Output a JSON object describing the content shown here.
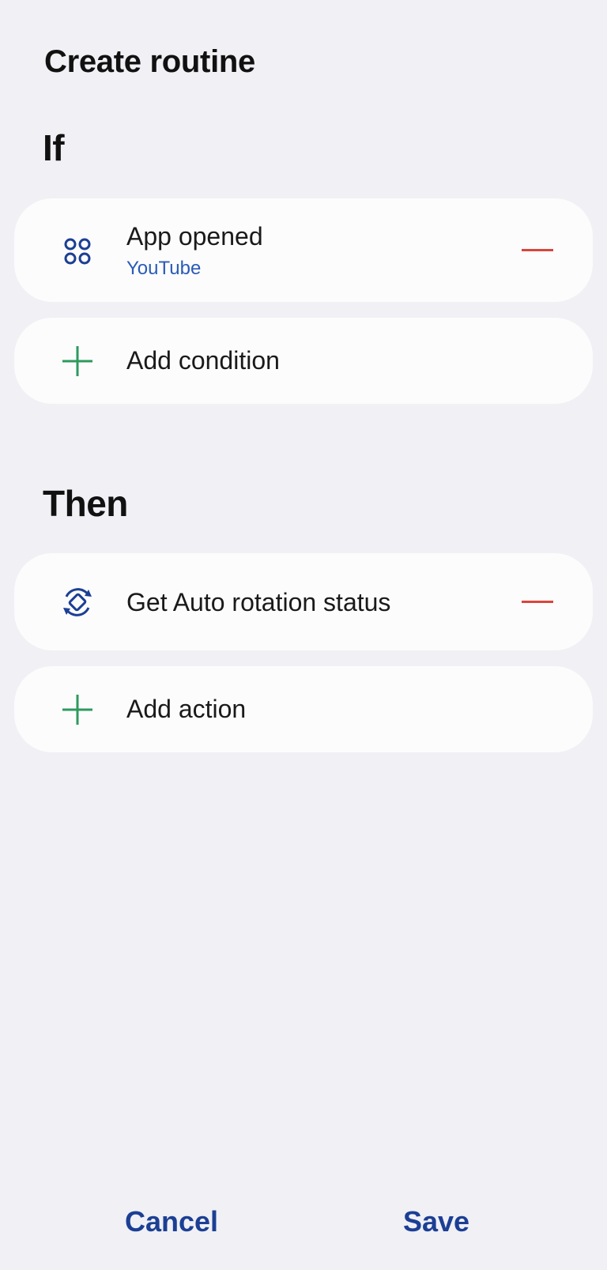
{
  "header": {
    "title": "Create routine"
  },
  "if_section": {
    "title": "If",
    "conditions": [
      {
        "icon": "apps-icon",
        "label": "App opened",
        "sublabel": "YouTube"
      }
    ],
    "add_label": "Add condition"
  },
  "then_section": {
    "title": "Then",
    "actions": [
      {
        "icon": "auto-rotate-icon",
        "label": "Get Auto rotation status"
      }
    ],
    "add_label": "Add action"
  },
  "footer": {
    "cancel_label": "Cancel",
    "save_label": "Save"
  },
  "colors": {
    "background": "#f0f0f5",
    "card": "#fcfcfc",
    "accent_blue": "#1c3f94",
    "sublabel_blue": "#2a5bb8",
    "remove_red": "#d9453d",
    "add_green": "#2e9a5e"
  }
}
